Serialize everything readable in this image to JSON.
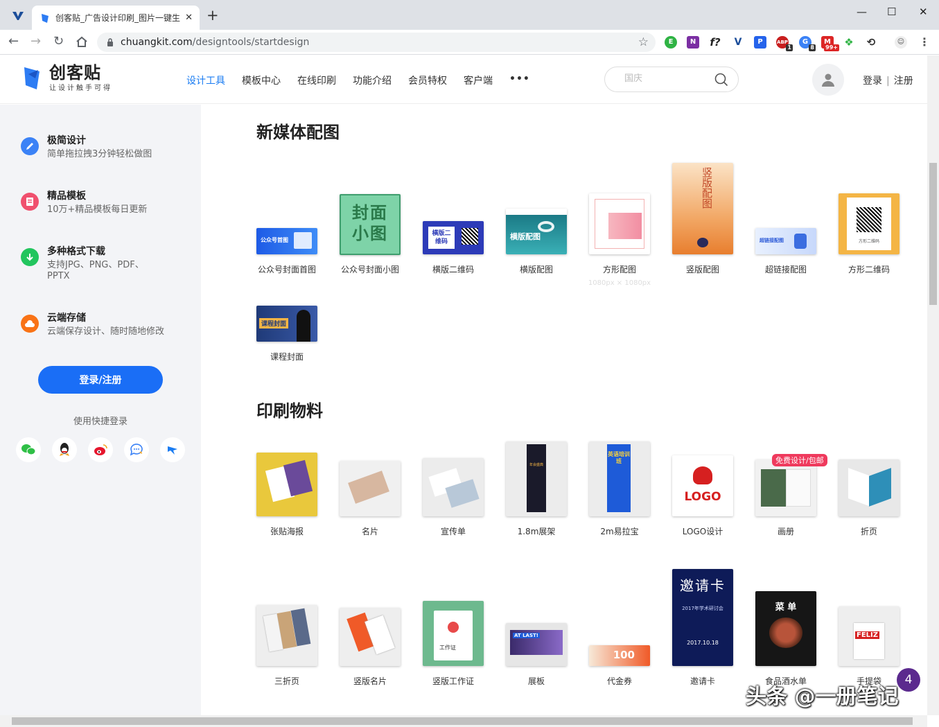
{
  "browser": {
    "tab_title": "创客贴_广告设计印刷_图片一键生",
    "url_host": "chuangkit.com",
    "url_path": "/designtools/startdesign",
    "ext_badges": [
      "1",
      "8",
      "99+"
    ]
  },
  "header": {
    "logo_name": "创客贴",
    "logo_slogan": "让设计触手可得",
    "menu": [
      "设计工具",
      "模板中心",
      "在线印刷",
      "功能介绍",
      "会员特权",
      "客户端",
      "•••"
    ],
    "search_placeholder": "国庆",
    "login": "登录",
    "sep": "|",
    "register": "注册"
  },
  "sidebar": {
    "features": [
      {
        "title": "极简设计",
        "desc": "简单拖拉拽3分钟轻松做图",
        "color": "#3b82f6"
      },
      {
        "title": "精品模板",
        "desc": "10万+精品模板每日更新",
        "color": "#f0506e"
      },
      {
        "title": "多种格式下载",
        "desc": "支持JPG、PNG、PDF、PPTX",
        "color": "#22c55e"
      },
      {
        "title": "云端存储",
        "desc": "云端保存设计、随时随地修改",
        "color": "#f97316"
      }
    ],
    "login_button": "登录/注册",
    "quick_login": "使用快捷登录"
  },
  "sections": [
    {
      "title": "新媒体配图",
      "items": [
        {
          "label": "公众号封面首图",
          "thumb_text": "公众号首图"
        },
        {
          "label": "公众号封面小图",
          "thumb_text": "封面小图"
        },
        {
          "label": "横版二维码",
          "thumb_text": "横版二维码"
        },
        {
          "label": "横版配图",
          "thumb_text": "横版配图"
        },
        {
          "label": "方形配图",
          "sub": "1080px × 1080px"
        },
        {
          "label": "竖版配图",
          "thumb_text": "竖版配图"
        },
        {
          "label": "超链接配图",
          "thumb_text": "超链接配图"
        },
        {
          "label": "方形二维码",
          "thumb_text": "方形二维码"
        },
        {
          "label": "课程封面",
          "thumb_text": "课程封面"
        }
      ]
    },
    {
      "title": "印刷物料",
      "items": [
        {
          "label": "张贴海报"
        },
        {
          "label": "名片"
        },
        {
          "label": "宣传单"
        },
        {
          "label": "1.8m展架",
          "thumb_text": "年会盛典"
        },
        {
          "label": "2m易拉宝",
          "thumb_text": "英语培训班"
        },
        {
          "label": "LOGO设计",
          "thumb_text": "LOGO"
        },
        {
          "label": "画册",
          "badge": "免费设计/包邮"
        },
        {
          "label": "折页"
        },
        {
          "label": "三折页"
        },
        {
          "label": "竖版名片"
        },
        {
          "label": "竖版工作证",
          "thumb_text": "工作证"
        },
        {
          "label": "展板",
          "thumb_text": "AT LAST!"
        },
        {
          "label": "代金券",
          "thumb_text": "100"
        },
        {
          "label": "邀请卡",
          "thumb_text": "邀请卡",
          "thumb_date": "2017.10.18",
          "thumb_sub": "2017年学术研讨会"
        },
        {
          "label": "食品酒水单",
          "thumb_text": "菜 单"
        },
        {
          "label": "手提袋",
          "thumb_text": "FELIZ"
        }
      ]
    }
  ],
  "watermark": {
    "text": "头条 @一册笔记",
    "badge": "4"
  }
}
